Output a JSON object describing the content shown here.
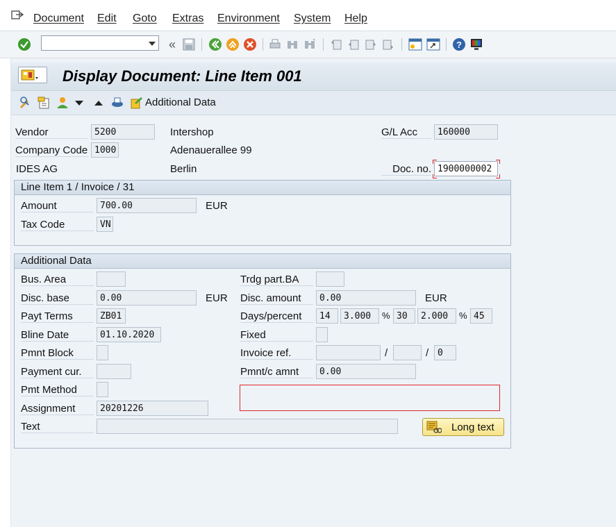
{
  "menu": {
    "items": [
      "Document",
      "Edit",
      "Goto",
      "Extras",
      "Environment",
      "System",
      "Help"
    ]
  },
  "system_toolbar": {
    "command_field_value": "",
    "back_label": "«"
  },
  "title": {
    "text": "Display Document: Line Item 001"
  },
  "app_toolbar": {
    "additional_data_label": "Additional Data"
  },
  "header": {
    "vendor_label": "Vendor",
    "vendor_value": "5200",
    "vendor_name": "Intershop",
    "company_code_label": "Company Code",
    "company_code_value": "1000",
    "street": "Adenauerallee 99",
    "company_name": "IDES AG",
    "city": "Berlin",
    "gl_acc_label": "G/L Acc",
    "gl_acc_value": "160000",
    "doc_no_label": "Doc. no.",
    "doc_no_value": "1900000002"
  },
  "line_item_group": {
    "title": "Line Item 1 / Invoice / 31",
    "amount_label": "Amount",
    "amount_value": "700.00",
    "amount_currency": "EUR",
    "tax_code_label": "Tax Code",
    "tax_code_value": "VN"
  },
  "additional_group": {
    "title": "Additional Data",
    "bus_area_label": "Bus. Area",
    "bus_area_value": "",
    "trdg_part_label": "Trdg part.BA",
    "trdg_part_value": "",
    "disc_base_label": "Disc. base",
    "disc_base_value": "0.00",
    "disc_base_currency": "EUR",
    "disc_amount_label": "Disc. amount",
    "disc_amount_value": "0.00",
    "disc_amount_currency": "EUR",
    "payt_terms_label": "Payt Terms",
    "payt_terms_value": "ZB01",
    "days_percent_label": "Days/percent",
    "days1": "14",
    "pct1": "3.000",
    "days2": "30",
    "pct2": "2.000",
    "days3": "45",
    "percent_sign": "%",
    "bline_date_label": "Bline Date",
    "bline_date_value": "01.10.2020",
    "fixed_label": "Fixed",
    "pmnt_block_label": "Pmnt Block",
    "invoice_ref_label": "Invoice ref.",
    "invoice_ref_value": "",
    "invoice_ref_part2": "",
    "invoice_ref_part3": "0",
    "slash": "/",
    "payment_cur_label": "Payment cur.",
    "pmnt_c_amnt_label": "Pmnt/c amnt",
    "pmnt_c_amnt_value": "0.00",
    "pmt_method_label": "Pmt Method",
    "assignment_label": "Assignment",
    "assignment_value": "20201226",
    "text_label": "Text",
    "text_value": "",
    "long_text_label": "Long text"
  },
  "colors": {
    "highlight_box": "#e0262a",
    "title_bg": "#d7e1ea",
    "button_bg": "#f6e38a"
  }
}
